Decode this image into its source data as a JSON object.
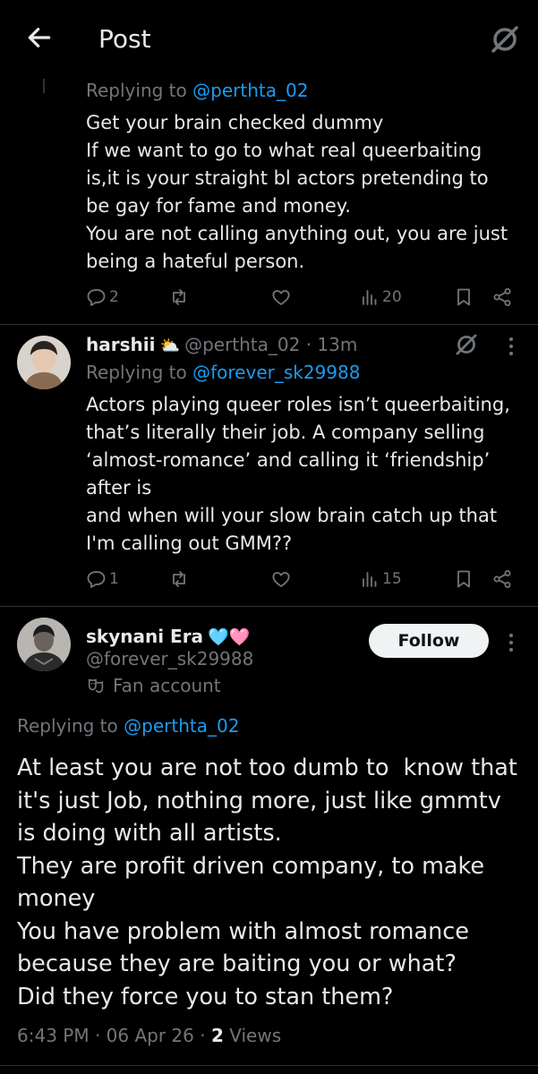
{
  "header": {
    "title": "Post"
  },
  "reply1": {
    "replying_prefix": "Replying to ",
    "replying_handle": "@perthta_02",
    "text": "Get your brain checked dummy\nIf we want to go to what real queerbaiting is,it is your straight bl actors pretending to be gay for fame and money.\nYou are not calling anything out, you are just being a hateful person.",
    "replies": "2",
    "views": "20"
  },
  "reply2": {
    "name": "harshii",
    "name_emoji": "⛅",
    "handle_time": "@perthta_02 · 13m",
    "replying_prefix": "Replying to ",
    "replying_handle": "@forever_sk29988",
    "text": "Actors playing queer roles isn’t queerbaiting, that’s literally their job. A company selling ‘almost-romance’ and calling it ‘friendship’ after is\nand when will your slow brain catch up that I'm calling out GMM??",
    "replies": "1",
    "views": "15"
  },
  "main_post": {
    "name": "skynani Era",
    "name_emoji": "🩵🩷",
    "handle": "@forever_sk29988",
    "badge": "Fan account",
    "follow_label": "Follow",
    "replying_prefix": "Replying to ",
    "replying_handle": "@perthta_02",
    "text": "At least you are not too dumb to  know that it's just Job, nothing more, just like gmmtv is doing with all artists.\nThey are profit driven company, to make money\nYou have problem with almost romance because they are baiting you or what?\nDid they force you to stan them?",
    "timestamp": "6:43 PM · 06 Apr 26 · ",
    "views_count": "2",
    "views_label": " Views"
  },
  "colors": {
    "accent": "#1d9bf0",
    "muted": "#71767b",
    "text": "#e7e9ea",
    "divider": "#2f3336"
  },
  "icons": [
    "back-arrow-icon",
    "grok-icon",
    "reply-icon",
    "repost-icon",
    "like-icon",
    "views-icon",
    "bookmark-icon",
    "share-icon",
    "more-icon",
    "theater-mask-icon"
  ]
}
